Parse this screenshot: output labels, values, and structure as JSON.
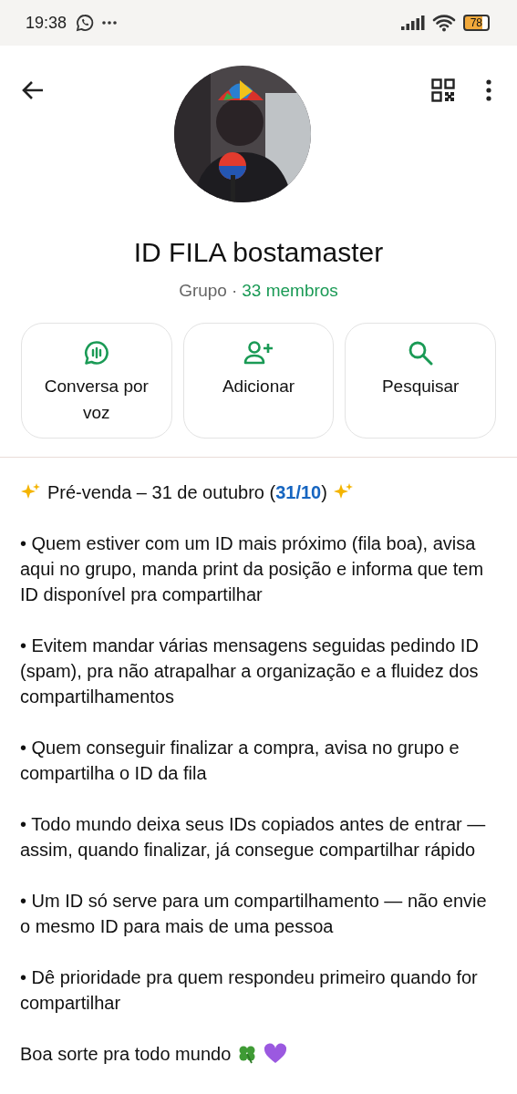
{
  "status_bar": {
    "time": "19:38",
    "battery": "78"
  },
  "group": {
    "name": "ID FILA bostamaster",
    "type": "Grupo",
    "separator": "·",
    "members": "33 membros"
  },
  "actions": [
    {
      "kind": "voice",
      "label": "Conversa por voz"
    },
    {
      "kind": "add",
      "label": "Adicionar"
    },
    {
      "kind": "search",
      "label": "Pesquisar"
    }
  ],
  "description": {
    "heading": {
      "before": "Pré-venda – 31 de outubro (",
      "link": "31/10",
      "after": ")"
    },
    "paragraphs": [
      "• Quem estiver com um ID mais próximo (fila boa), avisa aqui no grupo, manda print da posição e informa que tem ID disponível pra compartilhar",
      "• Evitem mandar várias mensagens seguidas pedindo ID (spam), pra não atrapalhar a organização e a fluidez dos compartilhamentos",
      "• Quem conseguir finalizar a compra, avisa no grupo e compartilha o ID da fila",
      "• Todo mundo deixa seus IDs copiados antes de entrar — assim, quando finalizar, já consegue compartilhar rápido",
      "• Um ID só serve para um compartilhamento — não envie o mesmo ID para mais de uma pessoa",
      "• Dê prioridade pra quem respondeu primeiro quando for compartilhar"
    ],
    "closing": "Boa sorte pra todo mundo"
  }
}
